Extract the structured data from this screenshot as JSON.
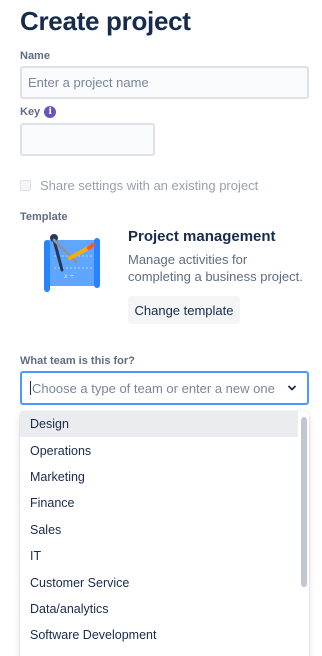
{
  "page": {
    "title": "Create project"
  },
  "name": {
    "label": "Name",
    "placeholder": "Enter a project name"
  },
  "key": {
    "label": "Key",
    "info_icon": "i",
    "value": ""
  },
  "share_settings": {
    "label": "Share settings with an existing project",
    "checked": false
  },
  "template": {
    "label": "Template",
    "title": "Project management",
    "description": "Manage activities for completing a business project.",
    "change_button": "Change template",
    "illustration_icon": "compass-blueprint-illustration"
  },
  "team": {
    "label": "What team is this for?",
    "placeholder": "Choose a type of team or enter a new one",
    "options": [
      "Design",
      "Operations",
      "Marketing",
      "Finance",
      "Sales",
      "IT",
      "Customer Service",
      "Data/analytics",
      "Software Development"
    ],
    "highlighted": "Design"
  },
  "colors": {
    "accent": "#4c9aff",
    "info": "#6554c0",
    "text": "#172b4d",
    "muted": "#5e6c84"
  }
}
